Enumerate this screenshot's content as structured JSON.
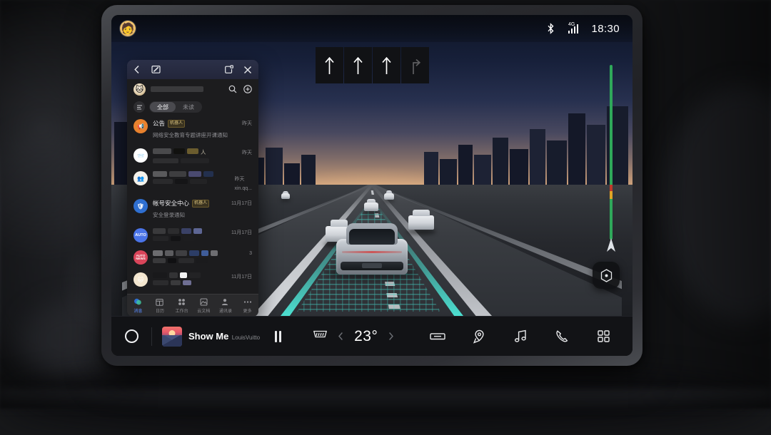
{
  "status_bar": {
    "avatar_icon": "person-emoji-avatar",
    "bluetooth_icon": "bluetooth-icon",
    "network_label": "4G",
    "signal_icon": "signal-bars-icon",
    "clock": "18:30"
  },
  "navigation": {
    "turn_arrows": [
      {
        "icon": "arrow-up-icon",
        "state": "active"
      },
      {
        "icon": "arrow-up-icon",
        "state": "active"
      },
      {
        "icon": "arrow-up-icon",
        "state": "active"
      },
      {
        "icon": "arrow-turn-right-icon",
        "state": "dim"
      }
    ],
    "route_rail": {
      "track_color": "#2fa85a",
      "congestion_red": "#c0392b",
      "congestion_yellow": "#e0a526",
      "marker_icon": "route-position-arrow-icon"
    },
    "locate_button_icon": "hexagon-location-icon"
  },
  "app_window": {
    "titlebar": {
      "back_icon": "chevron-left-icon",
      "restore_icon": "restore-window-icon",
      "split_icon": "split-screen-icon",
      "close_icon": "close-icon"
    },
    "profile": {
      "avatar_icon": "cat-avatar-icon",
      "name_redacted": true,
      "search_icon": "search-icon",
      "add_icon": "plus-circle-icon"
    },
    "filter": {
      "filter_icon": "filter-lines-icon",
      "chips": [
        {
          "label": "全部",
          "active": true
        },
        {
          "label": "未读",
          "active": false
        }
      ]
    },
    "chat_list": [
      {
        "avatar_icon": "megaphone-icon",
        "avatar_color": "#e8822e",
        "avatar_glyph": "📢",
        "title": "公告",
        "badge": "机器人",
        "subtitle": "网络安全教育专题讲座开课通知",
        "time": "昨天",
        "redacted": false
      },
      {
        "avatar_icon": "envelope-blue-icon",
        "avatar_color": "#ffffff",
        "avatar_glyph": "📨",
        "title": "",
        "badge": "",
        "subtitle": "",
        "time": "昨天",
        "redacted": true
      },
      {
        "avatar_icon": "group-gold-icon",
        "avatar_color": "#f5f2ea",
        "avatar_glyph": "👥",
        "title": "",
        "badge": "",
        "subtitle": "xin.qq...",
        "time": "昨天",
        "redacted": true
      },
      {
        "avatar_icon": "shield-security-icon",
        "avatar_color": "#2f6fd0",
        "avatar_glyph": "🛡",
        "title": "帐号安全中心",
        "badge": "机器人",
        "subtitle": "安全登录通知",
        "time": "11月17日",
        "redacted": false
      },
      {
        "avatar_icon": "auto-circle-icon",
        "avatar_color": "#4a74e8",
        "avatar_glyph": "AUTO",
        "title": "",
        "badge": "",
        "subtitle": "",
        "time": "11月17日",
        "redacted": true
      },
      {
        "avatar_icon": "auto-news-icon",
        "avatar_color": "#d9455a",
        "avatar_glyph": "AUTO NEWS",
        "title": "",
        "badge": "",
        "subtitle": "",
        "time": "3",
        "redacted": true
      },
      {
        "avatar_icon": "cartoon-avatar-icon",
        "avatar_color": "#f3e6cf",
        "avatar_glyph": "🐱",
        "title": "",
        "badge": "",
        "subtitle": "",
        "time": "11月17日",
        "redacted": true
      },
      {
        "avatar_icon": "blue-circle-avatar-icon",
        "avatar_color": "#2f6fd0",
        "avatar_glyph": "",
        "title": "",
        "badge": "",
        "subtitle": "",
        "time": "",
        "redacted": true
      }
    ],
    "tabs": [
      {
        "label": "消息",
        "icon": "messages-icon",
        "active": true
      },
      {
        "label": "日历",
        "icon": "calendar-icon",
        "active": false
      },
      {
        "label": "工作台",
        "icon": "workbench-grid-icon",
        "active": false
      },
      {
        "label": "云文档",
        "icon": "cloud-doc-icon",
        "active": false
      },
      {
        "label": "通讯录",
        "icon": "contacts-icon",
        "active": false
      },
      {
        "label": "更多",
        "icon": "more-dots-icon",
        "active": false
      }
    ]
  },
  "bottom_bar": {
    "home_icon": "home-circle-icon",
    "media": {
      "album_art_icon": "album-art-mountain-sunset",
      "title": "Show Me",
      "artist": "LouisVuitto",
      "pause_icon": "pause-icon"
    },
    "climate": {
      "defrost_icon": "rear-defrost-icon",
      "decrease_icon": "chevron-left-icon",
      "temperature": "23°",
      "increase_icon": "chevron-right-icon"
    },
    "quick_icons": [
      {
        "icon": "car-icon",
        "name": "vehicle-button"
      },
      {
        "icon": "map-pin-icon",
        "name": "navigation-button"
      },
      {
        "icon": "music-note-icon",
        "name": "music-button"
      },
      {
        "icon": "phone-icon",
        "name": "phone-button"
      },
      {
        "icon": "app-grid-icon",
        "name": "apps-button"
      }
    ]
  }
}
